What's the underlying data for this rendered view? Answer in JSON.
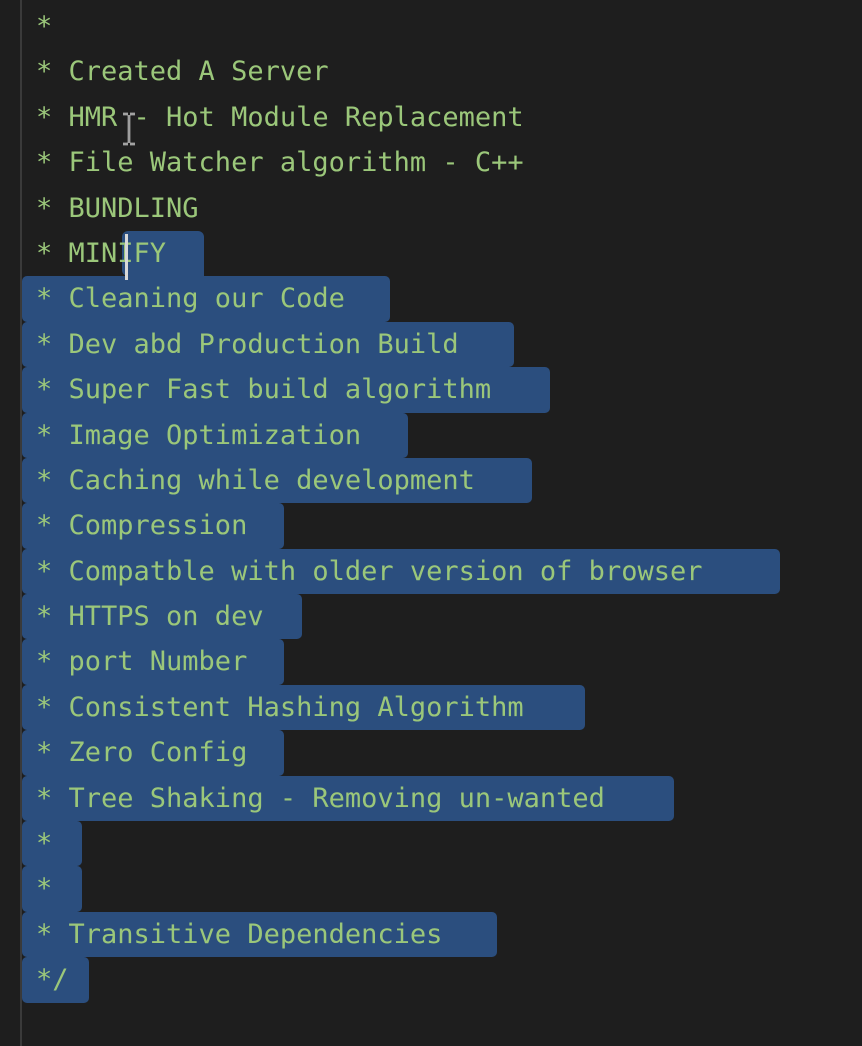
{
  "editor": {
    "lines": [
      {
        "text": "*",
        "selected": false
      },
      {
        "text": "* Created A Server",
        "selected": false
      },
      {
        "text": "* HMR - Hot Module Replacement",
        "selected": false
      },
      {
        "text": "* File Watcher algorithm - C++",
        "selected": false
      },
      {
        "text": "* BUNDLING",
        "selected": false
      },
      {
        "text": "* MINIFY",
        "selected": "partial"
      },
      {
        "text": "* Cleaning our Code",
        "selected": true
      },
      {
        "text": "* Dev abd Production Build",
        "selected": true
      },
      {
        "text": "* Super Fast build algorithm",
        "selected": true
      },
      {
        "text": "* Image Optimization",
        "selected": true
      },
      {
        "text": "* Caching while development",
        "selected": true
      },
      {
        "text": "* Compression",
        "selected": true
      },
      {
        "text": "* Compatble with older version of browser",
        "selected": true
      },
      {
        "text": "* HTTPS on dev",
        "selected": true
      },
      {
        "text": "* port Number",
        "selected": true
      },
      {
        "text": "* Consistent Hashing Algorithm",
        "selected": true
      },
      {
        "text": "* Zero Config",
        "selected": true
      },
      {
        "text": "* Tree Shaking - Removing un-wanted",
        "selected": true
      },
      {
        "text": "*",
        "selected": true
      },
      {
        "text": "*",
        "selected": true
      },
      {
        "text": "* Transitive Dependencies",
        "selected": true
      },
      {
        "text": "*/",
        "selected": true
      }
    ]
  },
  "colors": {
    "background": "#1e1e1e",
    "comment_text": "#9bc77a",
    "selection": "#2b4e7e"
  }
}
